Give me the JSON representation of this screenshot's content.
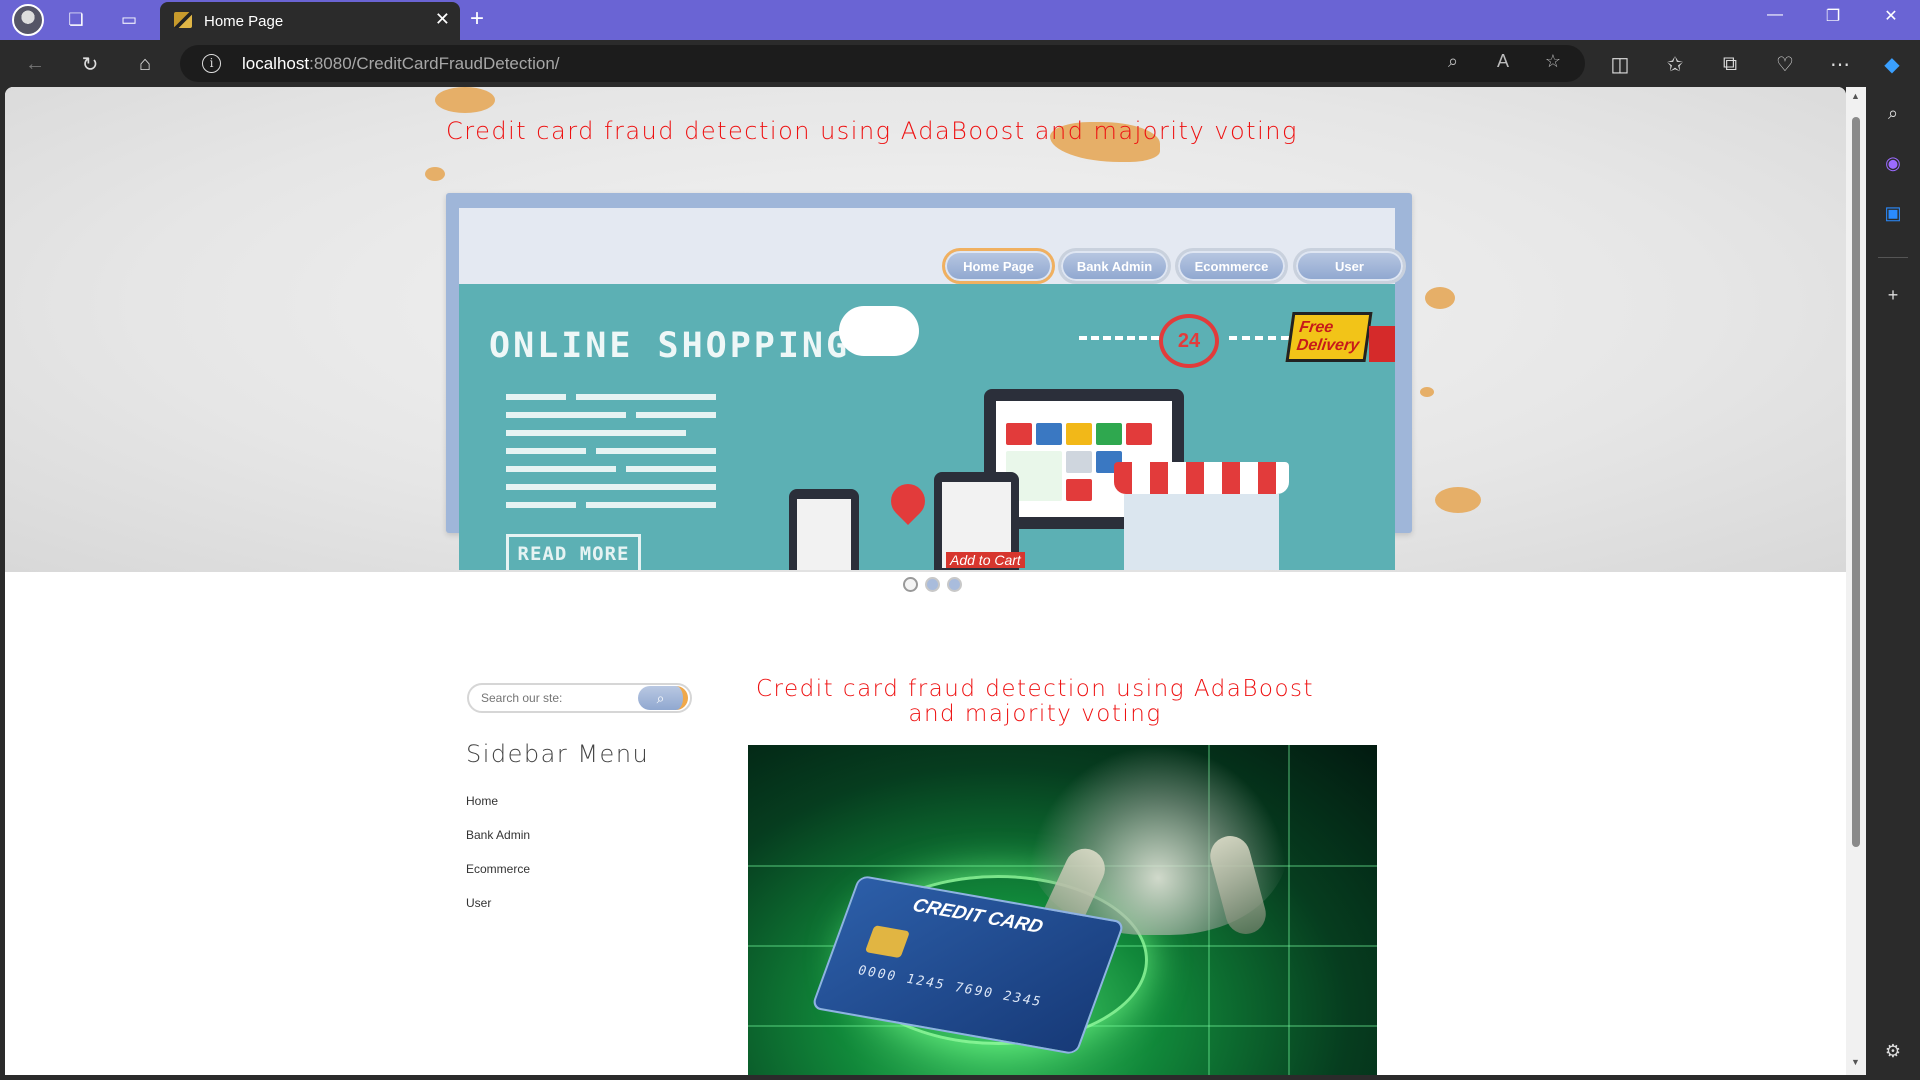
{
  "browser": {
    "tab_title": "Home Page",
    "url_host": "localhost",
    "url_rest": ":8080/CreditCardFraudDetection/"
  },
  "site": {
    "title": "Credit card fraud detection using AdaBoost and majority voting",
    "nav": [
      "Home Page",
      "Bank Admin",
      "Ecommerce",
      "User"
    ]
  },
  "banner": {
    "heading": "ONLINE  SHOPPING",
    "read_more": "READ MORE",
    "free_delivery": "Free Delivery",
    "badge_24": "24",
    "add_to_cart": "Add to Cart"
  },
  "slider": {
    "dot_count": 3,
    "active_index": 0
  },
  "search": {
    "placeholder": "Search our ste:"
  },
  "sidebar": {
    "title": "Sidebar Menu",
    "items": [
      "Home",
      "Bank Admin",
      "Ecommerce",
      "User"
    ]
  },
  "content": {
    "title": "Credit card fraud detection using AdaBoost and majority voting",
    "card_label": "CREDIT CARD",
    "card_number": "0000 1245 7690 2345"
  },
  "colors": {
    "tabbar": "#6a64d4",
    "title_red": "#ee1111",
    "banner_teal": "#5cb0b4"
  }
}
